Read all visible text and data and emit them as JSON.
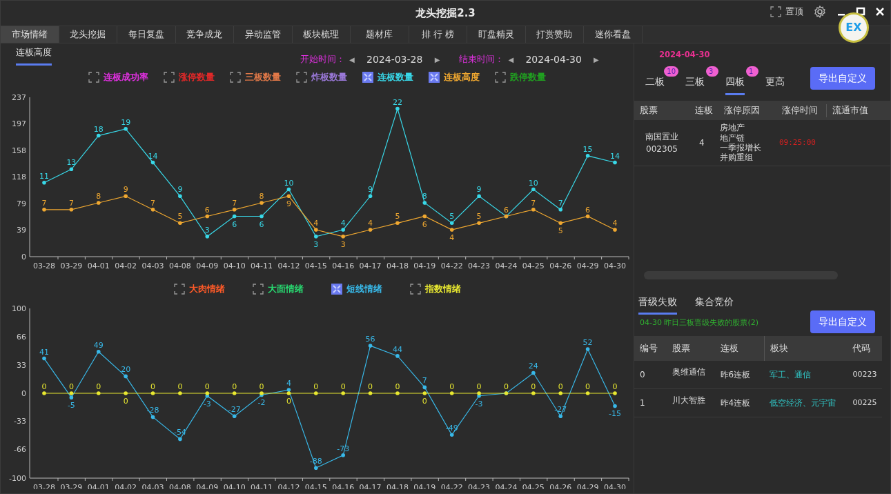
{
  "window": {
    "title": "龙头挖掘2.3",
    "pin_label": "置顶",
    "floating_ball": "EX"
  },
  "tabs": [
    {
      "label": "市场情绪",
      "selected": true
    },
    {
      "label": "龙头挖掘",
      "selected": false
    },
    {
      "label": "每日复盘",
      "selected": false
    },
    {
      "label": "竞争成龙",
      "selected": false
    },
    {
      "label": "异动监管",
      "selected": false
    },
    {
      "label": "板块梳理",
      "selected": false
    },
    {
      "label": "题材库",
      "selected": false
    },
    {
      "label": "排 行 榜",
      "selected": false
    },
    {
      "label": "盯盘精灵",
      "selected": false
    },
    {
      "label": "打赏赞助",
      "selected": false
    },
    {
      "label": "迷你看盘",
      "selected": false
    }
  ],
  "left": {
    "subtab": {
      "label": "连板高度",
      "selected": true
    },
    "start": {
      "label": "开始时间：",
      "prev": "◀",
      "value": "2024-03-28",
      "next": "▶"
    },
    "end": {
      "label": "结束时间：",
      "prev": "◀",
      "value": "2024-04-30",
      "next": "▶"
    },
    "legend_top": [
      {
        "label": "连板成功率",
        "checked": false,
        "color": "#e030e0"
      },
      {
        "label": "涨停数量",
        "checked": false,
        "color": "#e02828"
      },
      {
        "label": "三板数量",
        "checked": false,
        "color": "#e07848"
      },
      {
        "label": "炸板数量",
        "checked": false,
        "color": "#9a78d8"
      },
      {
        "label": "连板数量",
        "checked": true,
        "color": "#38d8e8"
      },
      {
        "label": "连板高度",
        "checked": true,
        "color": "#f0a830"
      },
      {
        "label": "跌停数量",
        "checked": false,
        "color": "#20a020"
      }
    ],
    "chart_top": {
      "chart_data": {
        "type": "line",
        "categories": [
          "03-28",
          "03-29",
          "04-01",
          "04-02",
          "04-03",
          "04-08",
          "04-09",
          "04-10",
          "04-11",
          "04-12",
          "04-15",
          "04-16",
          "04-17",
          "04-18",
          "04-19",
          "04-22",
          "04-23",
          "04-24",
          "04-25",
          "04-26",
          "04-29",
          "04-30"
        ],
        "ylim": [
          0,
          23.7
        ],
        "series": [
          {
            "color": "#38d8e8",
            "values": [
              11,
              13,
              18,
              19,
              14,
              9,
              3,
              6,
              6,
              10,
              3,
              4,
              9,
              22,
              8,
              5,
              9,
              6,
              10,
              7,
              15,
              14
            ],
            "value_labels": [
              "11",
              "13",
              "18",
              "19",
              "14",
              "9",
              "3",
              "6",
              "6",
              "10",
              "3",
              "4",
              "9",
              "22",
              "8",
              "5",
              "9",
              null,
              "10",
              "7",
              "15",
              "14"
            ]
          },
          {
            "color": "#f0a830",
            "values": [
              7,
              7,
              8,
              9,
              7,
              5,
              6,
              7,
              8,
              9,
              4,
              3,
              4,
              5,
              6,
              4,
              5,
              6,
              7,
              5,
              6,
              4
            ],
            "value_labels": [
              "7",
              "7",
              "8",
              "9",
              "7",
              "5",
              "6",
              "7",
              "8",
              "9",
              "4",
              "3",
              "4",
              "5",
              "6",
              "4",
              "5",
              "6",
              "7",
              "5",
              "6",
              "4"
            ]
          }
        ]
      },
      "y_axis_labels": [
        "237",
        "197",
        "158",
        "118",
        "79",
        "39",
        "0"
      ]
    },
    "legend_bottom": [
      {
        "label": "大肉情绪",
        "checked": false,
        "color": "#ff5a28"
      },
      {
        "label": "大面情绪",
        "checked": false,
        "color": "#28d870"
      },
      {
        "label": "短线情绪",
        "checked": true,
        "color": "#38b8e8"
      },
      {
        "label": "指数情绪",
        "checked": false,
        "color": "#e8e830"
      }
    ],
    "chart_bottom": {
      "chart_data": {
        "type": "line",
        "categories": [
          "03-28",
          "03-29",
          "04-01",
          "04-02",
          "04-03",
          "04-08",
          "04-09",
          "04-10",
          "04-11",
          "04-12",
          "04-15",
          "04-16",
          "04-17",
          "04-18",
          "04-19",
          "04-22",
          "04-23",
          "04-24",
          "04-25",
          "04-26",
          "04-29",
          "04-30"
        ],
        "ylim": [
          -100,
          100
        ],
        "yticks": [
          -100,
          -66,
          -33,
          0,
          33,
          66,
          100
        ],
        "series": [
          {
            "color": "#38b8e8",
            "values": [
              41,
              -5,
              49,
              20,
              -28,
              -54,
              -3,
              -27,
              -2,
              4,
              -88,
              -73,
              56,
              44,
              7,
              -49,
              -3,
              0,
              24,
              -27,
              52,
              -15
            ],
            "value_labels": [
              "41",
              "-5",
              "49",
              "20",
              "-28",
              "-54",
              "-3",
              "-27",
              "-2",
              "4",
              "-88",
              "-73",
              "56",
              "44",
              "7",
              "-49",
              "-3",
              null,
              "24",
              "-27",
              "52",
              "-15"
            ]
          },
          {
            "color": "#e8e830",
            "values": [
              0,
              0,
              0,
              0,
              0,
              0,
              0,
              0,
              0,
              0,
              0,
              0,
              0,
              0,
              0,
              0,
              0,
              0,
              0,
              0,
              0,
              0
            ],
            "value_labels": [
              "0",
              "0",
              "0",
              "0",
              "0",
              "0",
              "0",
              "0",
              "0",
              "0",
              "0",
              "0",
              "0",
              "0",
              "0",
              "0",
              "0",
              "0",
              "0",
              "0",
              "0",
              "0"
            ]
          }
        ]
      }
    }
  },
  "right": {
    "date": "2024-04-30",
    "board_tabs": [
      {
        "label": "二板",
        "badge": "10",
        "selected": false
      },
      {
        "label": "三板",
        "badge": "3",
        "selected": false
      },
      {
        "label": "四板",
        "badge": "1",
        "selected": true
      },
      {
        "label": "更高",
        "selected": false
      }
    ],
    "export_button": "导出自定义",
    "table": {
      "columns": [
        "股票",
        "连板",
        "涨停原因",
        "涨停时间",
        "流通市值"
      ],
      "rows": [
        {
          "stock": "南国置业",
          "code": "002305",
          "boards": "4",
          "reasons": [
            "房地产",
            "地产链",
            "一季报增长",
            "并购重组"
          ],
          "time": "09:25:00"
        }
      ]
    },
    "lower_tabs": [
      {
        "label": "晋级失败",
        "selected": true
      },
      {
        "label": "集合竞价",
        "selected": false
      }
    ],
    "note": "04-30 昨日三板晋级失败的股票(2)",
    "export_button_2": "导出自定义",
    "fail_table": {
      "columns": [
        "编号",
        "股票",
        "连板",
        "板块",
        "代码"
      ],
      "rows": [
        {
          "index": "0",
          "stock": "奥维通信",
          "boards": "昨6连板",
          "sector": "军工、通信",
          "code": "00223"
        },
        {
          "index": "1",
          "stock": "川大智胜",
          "boards": "昨4连板",
          "sector": "低空经济、元宇宙",
          "code": "00225"
        }
      ]
    }
  }
}
